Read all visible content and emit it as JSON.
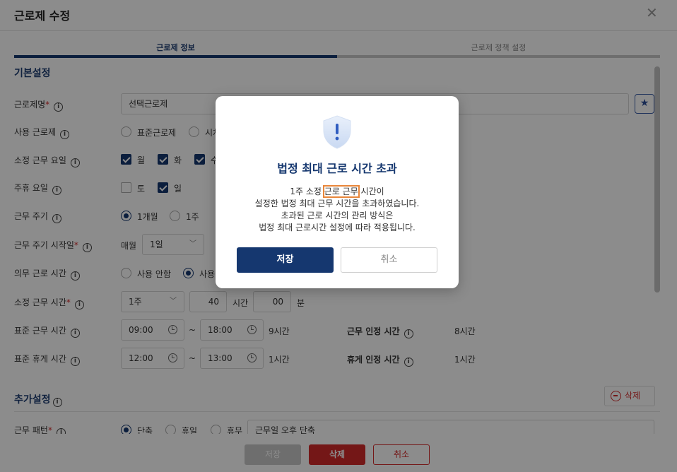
{
  "header": {
    "title": "근로제 수정",
    "close_glyph": "✕"
  },
  "tabs": [
    {
      "label": "근로제 정보"
    },
    {
      "label": "근로제 정책 설정"
    }
  ],
  "basic_section": {
    "title": "기본설정"
  },
  "rows": {
    "name": {
      "label": "근로제명",
      "value": "선택근로제"
    },
    "use_type": {
      "label": "사용 근로제",
      "options": [
        "표준근로제",
        "시차"
      ]
    },
    "workdays": {
      "label": "소정 근무 요일",
      "options": [
        "월",
        "화",
        "수"
      ]
    },
    "weekly_off": {
      "label": "주휴 요일",
      "options": [
        "토",
        "일"
      ]
    },
    "cycle": {
      "label": "근무 주기",
      "options": [
        "1개월",
        "1주"
      ]
    },
    "cycle_start": {
      "label": "근무 주기 시작일",
      "prefix": "매월",
      "value": "1일"
    },
    "mandatory": {
      "label": "의무 근로 시간",
      "options": [
        "사용 안함",
        "사용"
      ]
    },
    "contract_hours": {
      "label": "소정 근무 시간",
      "period": "1주",
      "hours": "40",
      "hours_unit": "시간",
      "minutes": "00",
      "minutes_unit": "분"
    },
    "std_work": {
      "label": "표준 근무 시간",
      "start": "09:00",
      "end": "18:00",
      "tilde": "~",
      "total": "9시간",
      "recog_label": "근무 인정 시간",
      "recog_value": "8시간"
    },
    "std_break": {
      "label": "표준 휴게 시간",
      "start": "12:00",
      "end": "13:00",
      "tilde": "~",
      "total": "1시간",
      "recog_label": "휴게 인정 시간",
      "recog_value": "1시간"
    }
  },
  "extra_section": {
    "title": "추가설정",
    "delete_label": "삭제"
  },
  "partial_row": {
    "label": "근무 패턴",
    "options": [
      "단축",
      "휴일",
      "휴무"
    ],
    "value": "근무일 오후 단축"
  },
  "footer": {
    "save": "저장",
    "delete": "삭제",
    "cancel": "취소"
  },
  "modal": {
    "title": "법정 최대 근로 시간 초과",
    "line1_pre": "1주 소정 ",
    "line1_hl": "근로 근무",
    "line1_post": " 시간이",
    "line2": "설정한 법정 최대 근무 시간을 초과하였습니다.",
    "line3": "초과된 근로 시간의 관리 방식은",
    "line4": "법정 최대 근로시간 설정에 따라 적용됩니다.",
    "confirm": "저장",
    "cancel": "취소"
  },
  "colors": {
    "primary": "#15376f",
    "danger": "#d32b2b",
    "highlight": "#e8863a"
  }
}
